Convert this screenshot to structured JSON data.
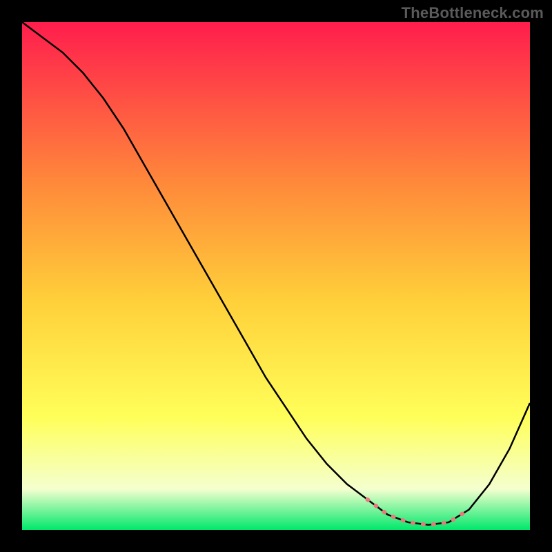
{
  "watermark": "TheBottleneck.com",
  "chart_data": {
    "type": "line",
    "title": "",
    "xlabel": "",
    "ylabel": "",
    "xlim": [
      0,
      100
    ],
    "ylim": [
      0,
      100
    ],
    "grid": false,
    "legend": false,
    "background_gradient": {
      "top": "#ff1d4d",
      "mid_upper": "#ff8a3a",
      "mid": "#ffd03a",
      "mid_lower": "#ffff5a",
      "lower": "#f4ffcf",
      "bottom": "#00e86b"
    },
    "series": [
      {
        "name": "main-curve",
        "color": "#000000",
        "x": [
          0,
          4,
          8,
          12,
          16,
          20,
          24,
          28,
          32,
          36,
          40,
          44,
          48,
          52,
          56,
          60,
          64,
          68,
          72,
          76,
          80,
          84,
          88,
          92,
          96,
          100
        ],
        "values": [
          100,
          97,
          94,
          90,
          85,
          79,
          72,
          65,
          58,
          51,
          44,
          37,
          30,
          24,
          18,
          13,
          9,
          6,
          3,
          1.5,
          1,
          1.5,
          4,
          9,
          16,
          25
        ]
      },
      {
        "name": "highlight-segment",
        "color": "#e77a7a",
        "stroke_width": 6,
        "dash": "1 14",
        "x": [
          68,
          72,
          76,
          80,
          84,
          88
        ],
        "values": [
          6,
          3,
          1.5,
          1,
          1.5,
          4
        ]
      }
    ]
  }
}
